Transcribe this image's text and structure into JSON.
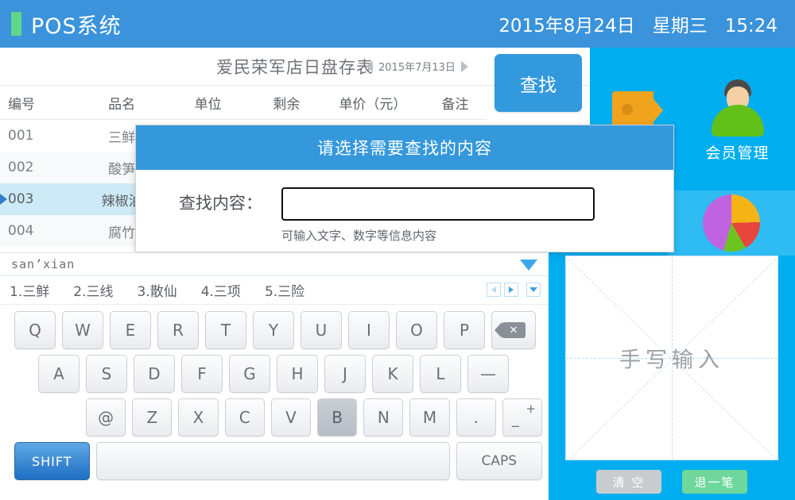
{
  "header": {
    "title": "POS系统",
    "date": "2015年8月24日",
    "weekday": "星期三",
    "time": "15:24",
    "accent_color": "#5fd68c",
    "bar_color": "#3a93db"
  },
  "sheet": {
    "title": "爱民荣军店日盘存表",
    "date": "2015年7月13日",
    "find_button": "查找",
    "columns": [
      "编号",
      "品名",
      "单位",
      "剩余",
      "单价（元）",
      "备注"
    ],
    "rows": [
      {
        "no": "001",
        "name": "三鲜",
        "unit": "",
        "left": "",
        "price": "",
        "memo": "",
        "selected": false
      },
      {
        "no": "002",
        "name": "酸笋",
        "unit": "",
        "left": "",
        "price": "",
        "memo": "",
        "selected": false
      },
      {
        "no": "003",
        "name": "辣椒油",
        "unit": "",
        "left": "",
        "price": "",
        "memo": "",
        "selected": true
      },
      {
        "no": "004",
        "name": "腐竹",
        "unit": "",
        "left": "",
        "price": "",
        "memo": "",
        "selected": false
      }
    ]
  },
  "tiles": {
    "tag_icon": "tag-icon",
    "member_label": "会员管理",
    "member_icon": "user-avatar-icon",
    "chart_icon": "pie-chart-icon"
  },
  "dialog": {
    "title": "请选择需要查找的内容",
    "label": "查找内容：",
    "input_value": "",
    "input_placeholder": "",
    "hint": "可输入文字、数字等信息内容",
    "header_color": "#3498db"
  },
  "ime": {
    "pinyin": "san’xian",
    "candidates": [
      "1.三鲜",
      "2.三线",
      "3.散仙",
      "4.三项",
      "5.三险"
    ],
    "collapse_icon": "chevron-down-icon",
    "prev_icon": "arrow-left-icon",
    "next_icon": "arrow-right-icon",
    "more_icon": "chevron-down-icon",
    "keyboard": {
      "row1": [
        "Q",
        "W",
        "E",
        "R",
        "T",
        "Y",
        "U",
        "I",
        "O",
        "P"
      ],
      "backspace_icon": "backspace-icon",
      "row2": [
        "A",
        "S",
        "D",
        "F",
        "G",
        "H",
        "J",
        "K",
        "L",
        "—"
      ],
      "row3": [
        "@",
        "Z",
        "X",
        "C",
        "V",
        "B",
        "N",
        "M",
        "."
      ],
      "plusminus": {
        "plus": "+",
        "minus": "_"
      },
      "pressed_key": "B",
      "shift": "SHIFT",
      "space": "",
      "caps": "CAPS"
    }
  },
  "handwriting": {
    "placeholder": "手写输入",
    "clear_button": "清 空",
    "undo_button": "退一笔"
  }
}
